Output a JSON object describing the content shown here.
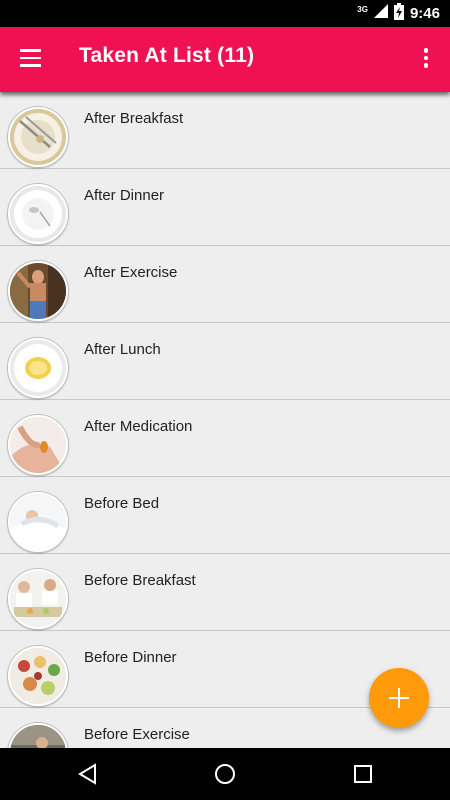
{
  "status_bar": {
    "network": "3G",
    "time": "9:46"
  },
  "app_bar": {
    "title": "Taken At List (11)",
    "menu_icon": "hamburger-menu-icon",
    "overflow_icon": "more-vert-icon",
    "color": "#f01152"
  },
  "list": {
    "items": [
      {
        "label": "After Breakfast",
        "thumb": "empty-plate-with-utensils"
      },
      {
        "label": "After Dinner",
        "thumb": "empty-white-plate"
      },
      {
        "label": "After Exercise",
        "thumb": "person-exercising"
      },
      {
        "label": "After Lunch",
        "thumb": "plate-with-food-remains"
      },
      {
        "label": "After Medication",
        "thumb": "hand-holding-pill"
      },
      {
        "label": "Before Bed",
        "thumb": "person-in-bed"
      },
      {
        "label": "Before Breakfast",
        "thumb": "breakfast-table"
      },
      {
        "label": "Before Dinner",
        "thumb": "dinner-buffet"
      },
      {
        "label": "Before Exercise",
        "thumb": "person-stretching"
      }
    ]
  },
  "fab": {
    "icon": "plus-icon",
    "color": "#ff9a0a"
  },
  "nav_bar": {
    "back_icon": "back-triangle-icon",
    "home_icon": "home-circle-icon",
    "recents_icon": "recents-square-icon"
  }
}
